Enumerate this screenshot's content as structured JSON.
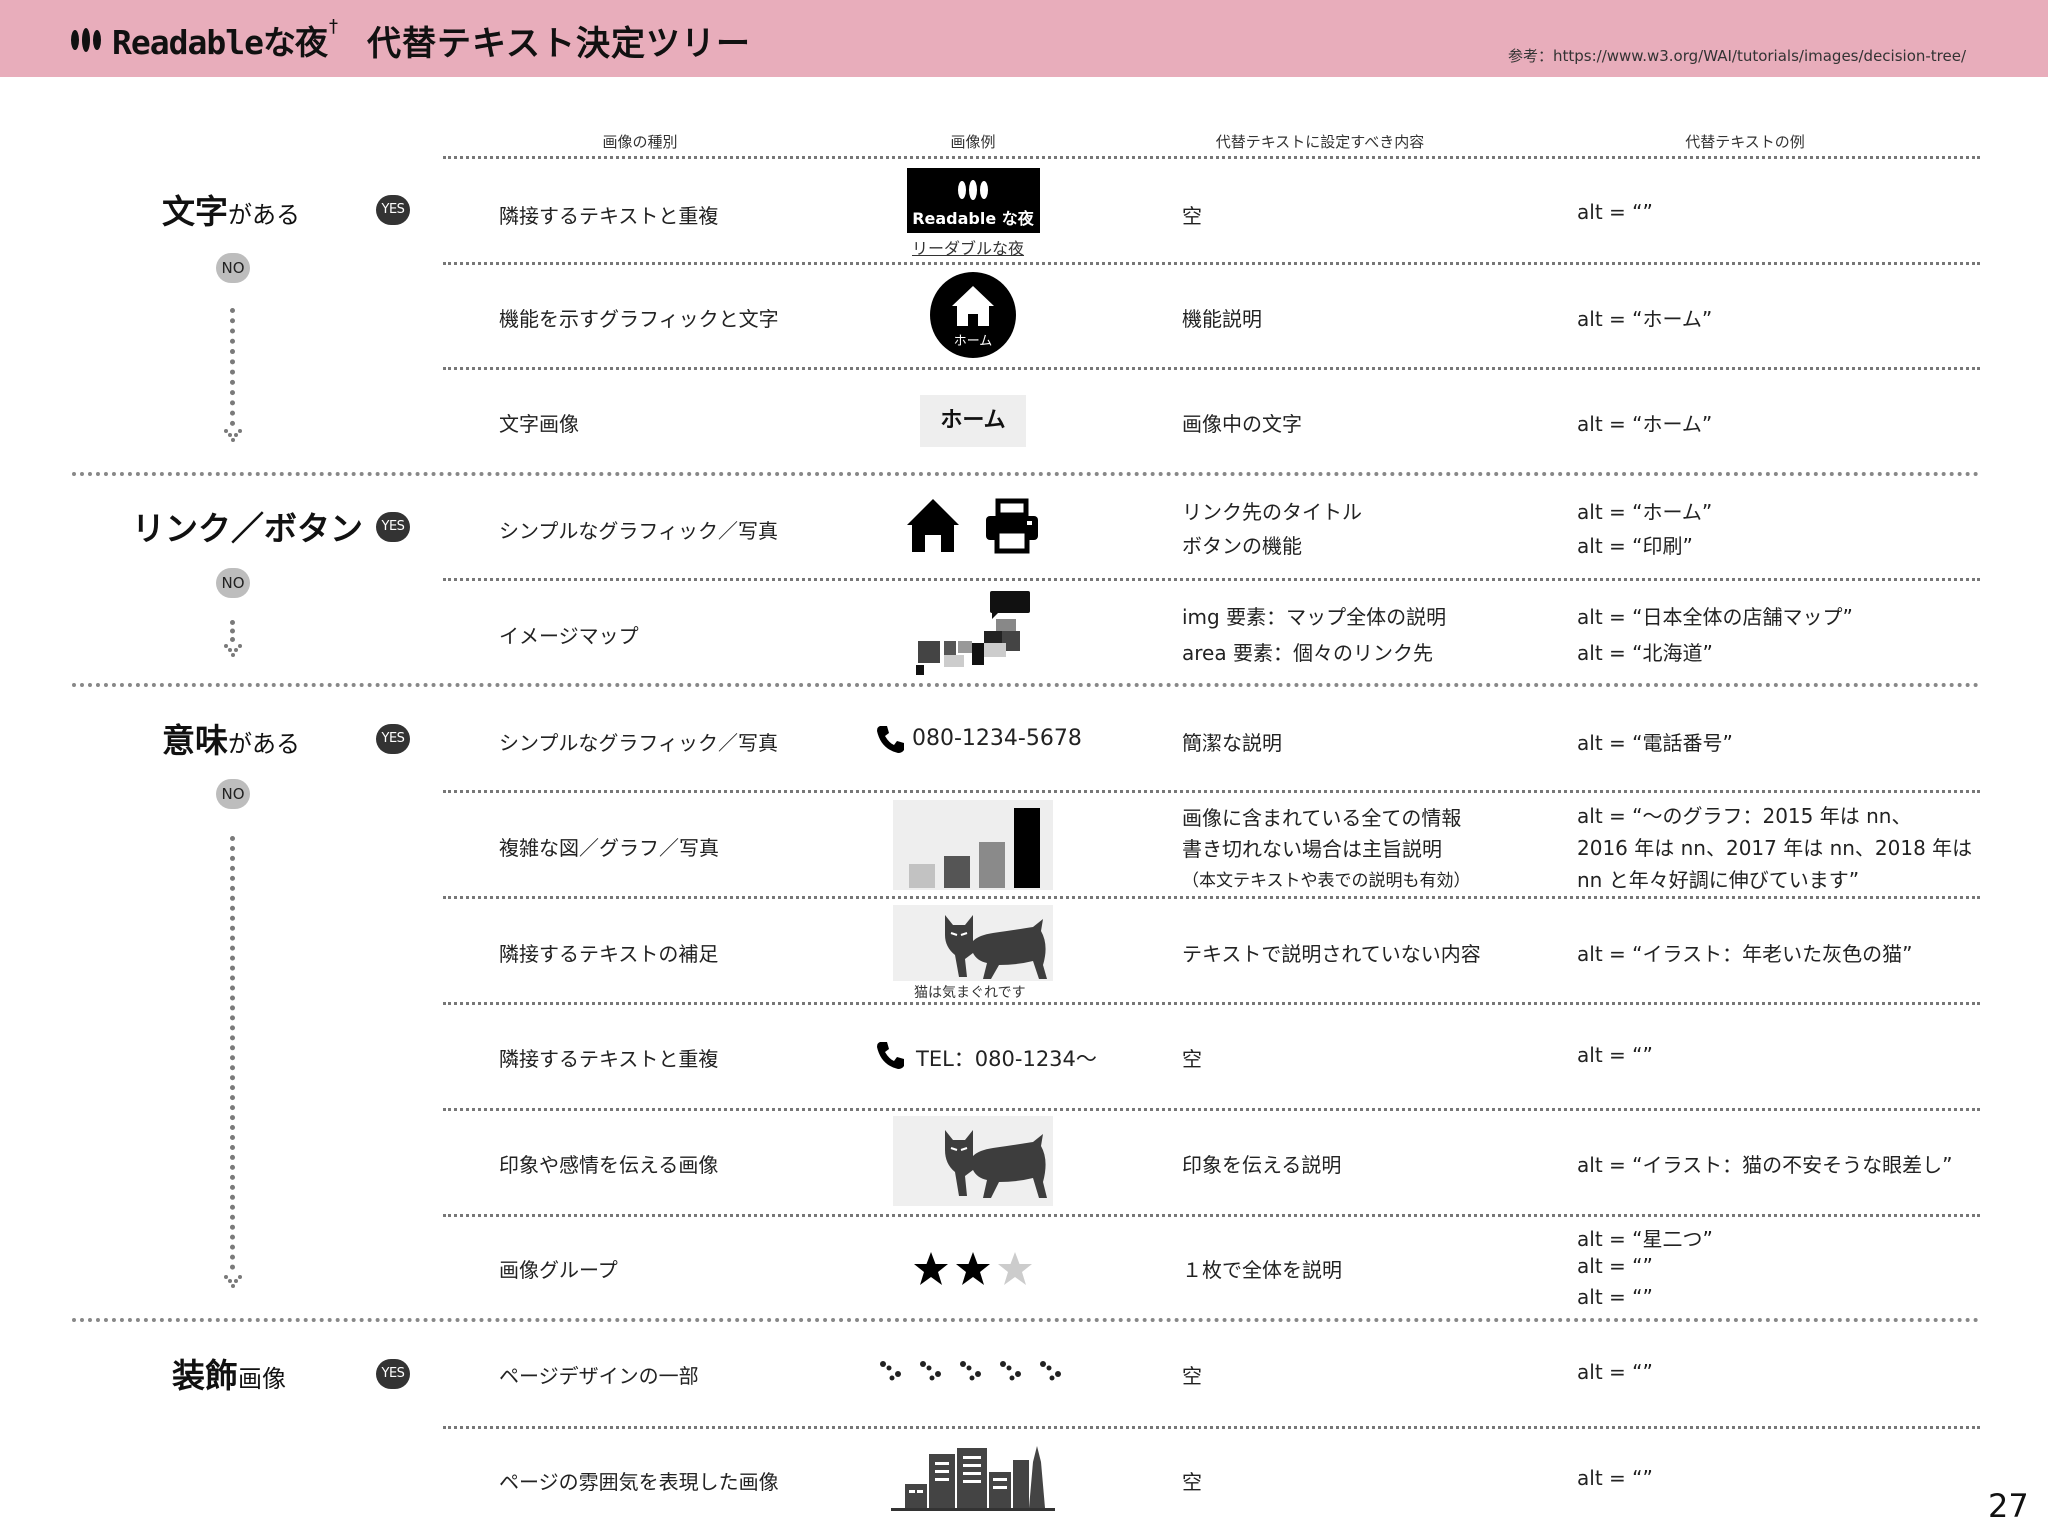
{
  "header": {
    "logo_text": "Readableな夜",
    "logo_mark": "†",
    "title": "代替テキスト決定ツリー",
    "reference": "参考：https://www.w3.org/WAI/tutorials/images/decision-tree/"
  },
  "page_number": "27",
  "columns": [
    "画像の種別",
    "画像例",
    "代替テキストに設定すべき内容",
    "代替テキストの例"
  ],
  "badges": {
    "yes": "YES",
    "no": "NO"
  },
  "categories": [
    {
      "big": "文字",
      "small": "がある"
    },
    {
      "big": "リンク／ボタン",
      "small": ""
    },
    {
      "big": "意味",
      "small": "がある"
    },
    {
      "big": "装飾",
      "small": "画像"
    }
  ],
  "rows": [
    {
      "type": "隣接するテキストと重複",
      "image_icon": "logo-image",
      "image_caption": "リーダブルな夜",
      "content": [
        "空"
      ],
      "alt": [
        "alt = “”"
      ]
    },
    {
      "type": "機能を示すグラフィックと文字",
      "image_icon": "home-circle-icon",
      "image_label": "ホーム",
      "content": [
        "機能説明"
      ],
      "alt": [
        "alt = “ホーム”"
      ]
    },
    {
      "type": "文字画像",
      "image_icon": "text-image",
      "image_label": "ホーム",
      "content": [
        "画像中の文字"
      ],
      "alt": [
        "alt = “ホーム”"
      ]
    },
    {
      "type": "シンプルなグラフィック／写真",
      "image_icon": "home-and-printer-icons",
      "content": [
        "リンク先のタイトル",
        "ボタンの機能"
      ],
      "alt": [
        "alt = “ホーム”",
        "alt = “印刷”"
      ]
    },
    {
      "type": "イメージマップ",
      "image_icon": "japan-map-icon",
      "content": [
        "img 要素：マップ全体の説明",
        "area 要素：個々のリンク先"
      ],
      "alt": [
        "alt = “日本全体の店舗マップ”",
        "alt = “北海道”"
      ]
    },
    {
      "type": "シンプルなグラフィック／写真",
      "image_icon": "phone-icon",
      "image_label": "080-1234-5678",
      "content": [
        "簡潔な説明"
      ],
      "alt": [
        "alt = “電話番号”"
      ]
    },
    {
      "type": "複雑な図／グラフ／写真",
      "image_icon": "bar-graph-image",
      "content": [
        "画像に含まれている全ての情報",
        "書き切れない場合は主旨説明",
        "（本文テキストや表での説明も有効）"
      ],
      "alt": [
        "alt = “〜のグラフ：2015 年は nn、",
        "2016 年は nn、2017 年は nn、2018 年は",
        "nn と年々好調に伸びています”"
      ]
    },
    {
      "type": "隣接するテキストの補足",
      "image_icon": "cat-image",
      "image_caption": "猫は気まぐれです",
      "content": [
        "テキストで説明されていない内容"
      ],
      "alt": [
        "alt = “イラスト：年老いた灰色の猫”"
      ]
    },
    {
      "type": "隣接するテキストと重複",
      "image_icon": "phone-icon",
      "image_label": "TEL：080-1234〜",
      "content": [
        "空"
      ],
      "alt": [
        "alt = “”"
      ]
    },
    {
      "type": "印象や感情を伝える画像",
      "image_icon": "cat-image",
      "content": [
        "印象を伝える説明"
      ],
      "alt": [
        "alt = “イラスト：猫の不安そうな眼差し”"
      ]
    },
    {
      "type": "画像グループ",
      "image_icon": "star-rating",
      "rating": 2,
      "rating_max": 3,
      "content": [
        "１枚で全体を説明"
      ],
      "alt": [
        "alt = “星二つ”",
        "alt = “”",
        "alt = “”"
      ]
    },
    {
      "type": "ページデザインの一部",
      "image_icon": "paw-prints",
      "content": [
        "空"
      ],
      "alt": [
        "alt = “”"
      ]
    },
    {
      "type": "ページの雰囲気を表現した画像",
      "image_icon": "city-skyline-image",
      "content": [
        "空"
      ],
      "alt": [
        "alt = “”"
      ]
    }
  ]
}
